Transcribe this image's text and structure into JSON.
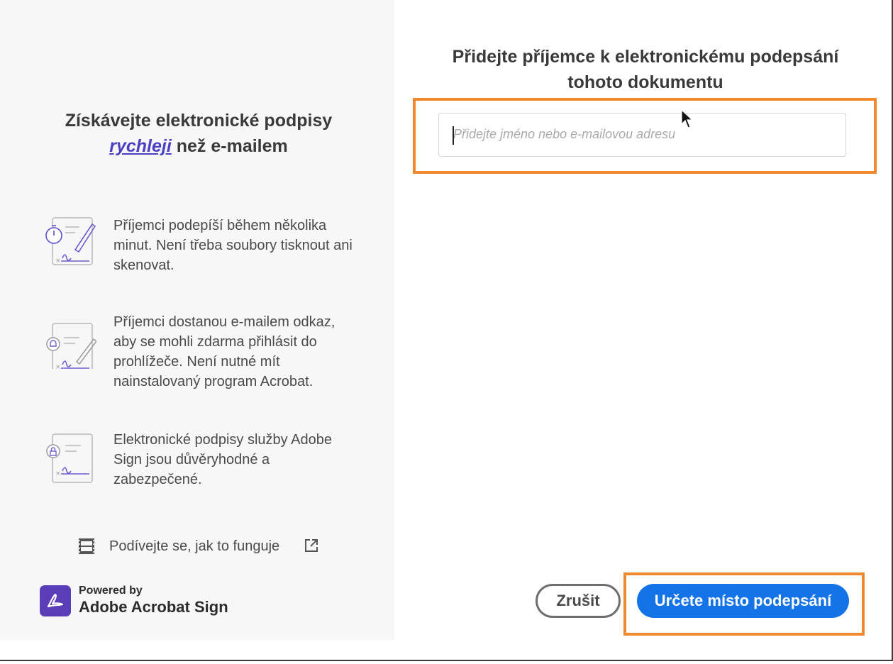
{
  "left": {
    "title_line1": "Získávejte elektronické podpisy",
    "title_link": "rychleji",
    "title_line2_rest": " než e-mailem",
    "features": [
      {
        "text": "Příjemci podepíší během několika minut. Není třeba soubory tisknout ani skenovat.",
        "icon": "stopwatch-sign-document-icon"
      },
      {
        "text": "Příjemci dostanou e-mailem odkaz, aby se mohli zdarma přihlásit do prohlížeče. Není nutné mít nainstalovaný program Acrobat.",
        "icon": "bell-sign-document-icon"
      },
      {
        "text": "Elektronické podpisy služby Adobe Sign jsou důvěryhodné a zabezpečené.",
        "icon": "lock-sign-document-icon"
      }
    ],
    "how_it_works": "Podívejte se, jak to funguje",
    "powered_by": "Powered by",
    "brand_name": "Adobe Acrobat Sign"
  },
  "right": {
    "title": "Přidejte příjemce k elektronickému podepsání tohoto dokumentu",
    "recipient_placeholder": "Přidejte jméno nebo e-mailovou adresu",
    "recipient_value": ""
  },
  "buttons": {
    "cancel": "Zrušit",
    "primary": "Určete místo podepsání"
  },
  "colors": {
    "accent": "#1473e6",
    "highlight": "#f0882e",
    "link": "#4b3fc4",
    "brand": "#5a3eb8"
  }
}
